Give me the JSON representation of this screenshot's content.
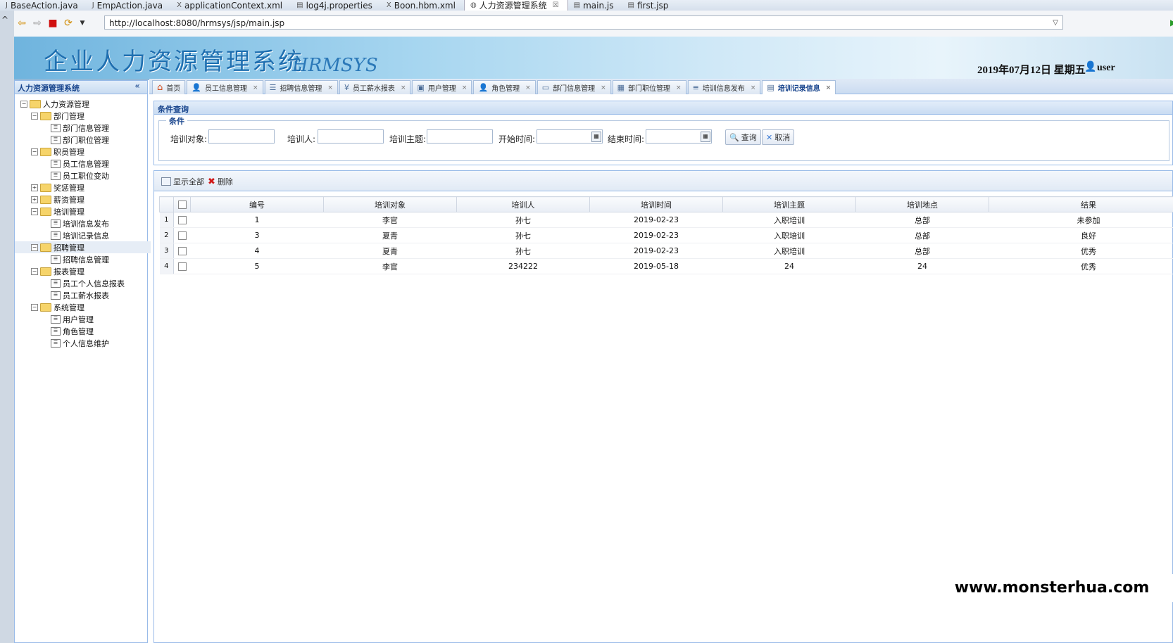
{
  "editor_tabs": [
    {
      "label": "BaseAction.java",
      "icon": "java-file-icon"
    },
    {
      "label": "EmpAction.java",
      "icon": "java-file-icon"
    },
    {
      "label": "applicationContext.xml",
      "icon": "xml-file-icon"
    },
    {
      "label": "log4j.properties",
      "icon": "properties-file-icon"
    },
    {
      "label": "Boon.hbm.xml",
      "icon": "xml-file-icon"
    },
    {
      "label": "人力资源管理系统",
      "icon": "globe-icon",
      "active": true,
      "close": "☒"
    },
    {
      "label": "main.js",
      "icon": "js-file-icon"
    },
    {
      "label": "first.jsp",
      "icon": "jsp-file-icon"
    }
  ],
  "left_rail": {
    "label": "^"
  },
  "browser": {
    "url": "http://localhost:8080/hrmsys/jsp/main.jsp",
    "icons": [
      "back-icon",
      "forward-icon",
      "stop-icon",
      "refresh-icon",
      "menu-dropdown-icon",
      "go-icon"
    ]
  },
  "banner": {
    "title": "企业人力资源管理系统",
    "subtitle": "HRMSYS",
    "date": "2019年07月12日 星期五",
    "user": "user"
  },
  "sidebar": {
    "title": "人力资源管理系统",
    "collapse": "«",
    "tree": [
      {
        "label": "人力资源管理",
        "level": 0,
        "type": "folder",
        "pm": "⊟"
      },
      {
        "label": "部门管理",
        "level": 1,
        "type": "folder",
        "pm": "⊟"
      },
      {
        "label": "部门信息管理",
        "level": 2,
        "type": "leaf"
      },
      {
        "label": "部门职位管理",
        "level": 2,
        "type": "leaf"
      },
      {
        "label": "职员管理",
        "level": 1,
        "type": "folder",
        "pm": "⊟"
      },
      {
        "label": "员工信息管理",
        "level": 2,
        "type": "leaf"
      },
      {
        "label": "员工职位变动",
        "level": 2,
        "type": "leaf"
      },
      {
        "label": "奖惩管理",
        "level": 1,
        "type": "folder",
        "pm": "⊞"
      },
      {
        "label": "薪资管理",
        "level": 1,
        "type": "folder",
        "pm": "⊞"
      },
      {
        "label": "培训管理",
        "level": 1,
        "type": "folder",
        "pm": "⊟"
      },
      {
        "label": "培训信息发布",
        "level": 2,
        "type": "leaf"
      },
      {
        "label": "培训记录信息",
        "level": 2,
        "type": "leaf"
      },
      {
        "label": "招聘管理",
        "level": 1,
        "type": "folder",
        "pm": "⊟",
        "selected": true
      },
      {
        "label": "招聘信息管理",
        "level": 2,
        "type": "leaf"
      },
      {
        "label": "报表管理",
        "level": 1,
        "type": "folder",
        "pm": "⊟"
      },
      {
        "label": "员工个人信息报表",
        "level": 2,
        "type": "leaf"
      },
      {
        "label": "员工薪水报表",
        "level": 2,
        "type": "leaf"
      },
      {
        "label": "系统管理",
        "level": 1,
        "type": "folder",
        "pm": "⊟"
      },
      {
        "label": "用户管理",
        "level": 2,
        "type": "leaf"
      },
      {
        "label": "角色管理",
        "level": 2,
        "type": "leaf"
      },
      {
        "label": "个人信息维护",
        "level": 2,
        "type": "leaf"
      }
    ]
  },
  "main_tabs": [
    {
      "label": "首页",
      "icon": "home-icon",
      "closable": false
    },
    {
      "label": "员工信息管理",
      "icon": "user-icon",
      "closable": true
    },
    {
      "label": "招聘信息管理",
      "icon": "list-icon",
      "closable": true
    },
    {
      "label": "员工薪水报表",
      "icon": "yen-icon",
      "closable": true
    },
    {
      "label": "用户管理",
      "icon": "id-card-icon",
      "closable": true
    },
    {
      "label": "角色管理",
      "icon": "user-icon",
      "closable": true
    },
    {
      "label": "部门信息管理",
      "icon": "monitor-icon",
      "closable": true
    },
    {
      "label": "部门职位管理",
      "icon": "grid-icon",
      "closable": true
    },
    {
      "label": "培训信息发布",
      "icon": "lines-icon",
      "closable": true
    },
    {
      "label": "培训记录信息",
      "icon": "table-icon",
      "closable": true,
      "active": true
    }
  ],
  "tab_close": "×",
  "query": {
    "panel_title": "条件查询",
    "legend": "条件",
    "fields": [
      {
        "label": "培训对象:",
        "value": ""
      },
      {
        "label": "培训人:",
        "value": ""
      },
      {
        "label": "培训主题:",
        "value": ""
      },
      {
        "label": "开始时间:",
        "value": "",
        "calendar": true
      },
      {
        "label": "结束时间:",
        "value": "",
        "calendar": true
      }
    ],
    "search_label": "查询",
    "cancel_label": "取消"
  },
  "grid": {
    "show_all_label": "显示全部",
    "delete_label": "删除",
    "columns": [
      "编号",
      "培训对象",
      "培训人",
      "培训时间",
      "培训主题",
      "培训地点",
      "结果"
    ],
    "rows": [
      {
        "rn": "1",
        "cells": [
          "1",
          "李官",
          "孙七",
          "2019-02-23",
          "入职培训",
          "总部",
          "未参加"
        ]
      },
      {
        "rn": "2",
        "cells": [
          "3",
          "夏青",
          "孙七",
          "2019-02-23",
          "入职培训",
          "总部",
          "良好"
        ]
      },
      {
        "rn": "3",
        "cells": [
          "4",
          "夏青",
          "孙七",
          "2019-02-23",
          "入职培训",
          "总部",
          "优秀"
        ]
      },
      {
        "rn": "4",
        "cells": [
          "5",
          "李官",
          "234222",
          "2019-05-18",
          "24",
          "24",
          "优秀"
        ]
      }
    ]
  },
  "watermark": "www.monsterhua.com"
}
